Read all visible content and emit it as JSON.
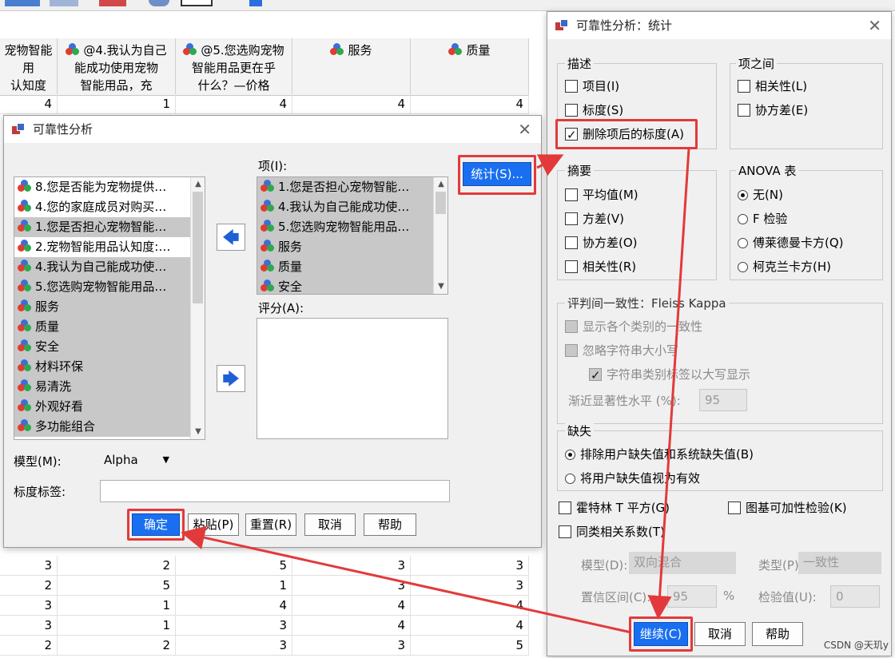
{
  "spreadsheet": {
    "headers": [
      {
        "text": "宠物智能用\n认知度",
        "icon": false
      },
      {
        "text": "@4.我认为自己\n能成功使用宠物\n智能用品，充",
        "icon": true
      },
      {
        "text": "@5.您选购宠物\n智能用品更在乎\n什么？—价格",
        "icon": true
      },
      {
        "text": "服务",
        "icon": true
      },
      {
        "text": "质量",
        "icon": true
      }
    ],
    "top_row": [
      "4",
      "1",
      "4",
      "4",
      "4"
    ],
    "bottom_rows": [
      [
        "3",
        "2",
        "5",
        "3",
        "3"
      ],
      [
        "2",
        "5",
        "1",
        "3",
        "3"
      ],
      [
        "3",
        "1",
        "4",
        "4",
        "4"
      ],
      [
        "3",
        "1",
        "3",
        "4",
        "4"
      ],
      [
        "2",
        "2",
        "3",
        "3",
        "5"
      ]
    ]
  },
  "reliability_dialog": {
    "title": "可靠性分析",
    "source_items": [
      "8.您是否能为宠物提供…",
      "4.您的家庭成员对购买…",
      "1.您是否担心宠物智能…",
      "2.宠物智能用品认知度:…",
      "4.我认为自己能成功使…",
      "5.您选购宠物智能用品…",
      "服务",
      "质量",
      "安全",
      "材料环保",
      "易清洗",
      "外观好看",
      "多功能组合"
    ],
    "items_label": "项(I):",
    "target_items": [
      "1.您是否担心宠物智能…",
      "4.我认为自己能成功使…",
      "5.您选购宠物智能用品…",
      "服务",
      "质量",
      "安全"
    ],
    "ratings_label": "评分(A):",
    "statistics_button": "统计(S)...",
    "model_label": "模型(M):",
    "model_value": "Alpha",
    "scale_label": "标度标签:",
    "scale_value": "",
    "buttons": {
      "ok": "确定",
      "paste": "粘贴(P)",
      "reset": "重置(R)",
      "cancel": "取消",
      "help": "帮助"
    }
  },
  "stats_dialog": {
    "title": "可靠性分析：统计",
    "descriptives": {
      "title": "描述",
      "item": "项目(I)",
      "scale": "标度(S)",
      "scale_if_deleted": "删除项后的标度(A)"
    },
    "inter_item": {
      "title": "项之间",
      "correlations": "相关性(L)",
      "covariances": "协方差(E)"
    },
    "summaries": {
      "title": "摘要",
      "means": "平均值(M)",
      "variances": "方差(V)",
      "covariances": "协方差(O)",
      "correlations": "相关性(R)"
    },
    "anova": {
      "title": "ANOVA 表",
      "none": "无(N)",
      "f_test": "F 检验",
      "friedman": "傅莱德曼卡方(Q)",
      "cochran": "柯克兰卡方(H)"
    },
    "fleiss": {
      "title": "评判间一致性：Fleiss Kappa",
      "show_each": "显示各个类别的一致性",
      "ignore_case": "忽略字符串大小写",
      "upper_case": "字符串类别标签以大写显示",
      "sig_label": "渐近显著性水平 (%):",
      "sig_value": "95"
    },
    "missing": {
      "title": "缺失",
      "exclude": "排除用户缺失值和系统缺失值(B)",
      "valid": "将用户缺失值视为有效"
    },
    "hotelling": "霍特林 T 平方(G)",
    "tukey": "图基可加性检验(K)",
    "icc": "同类相关系数(T)",
    "icc_model_label": "模型(D):",
    "icc_model_value": "双向混合",
    "icc_type_label": "类型(P):",
    "icc_type_value": "一致性",
    "ci_label": "置信区间(C):",
    "ci_value": "95",
    "ci_unit": "%",
    "test_value_label": "检验值(U):",
    "test_value": "0",
    "buttons": {
      "continue": "继续(C)",
      "cancel": "取消",
      "help": "帮助"
    }
  },
  "watermark": "CSDN @天玑y",
  "colors": {
    "highlight": "#e23a3a",
    "primary_button": "#1a6ff0"
  }
}
